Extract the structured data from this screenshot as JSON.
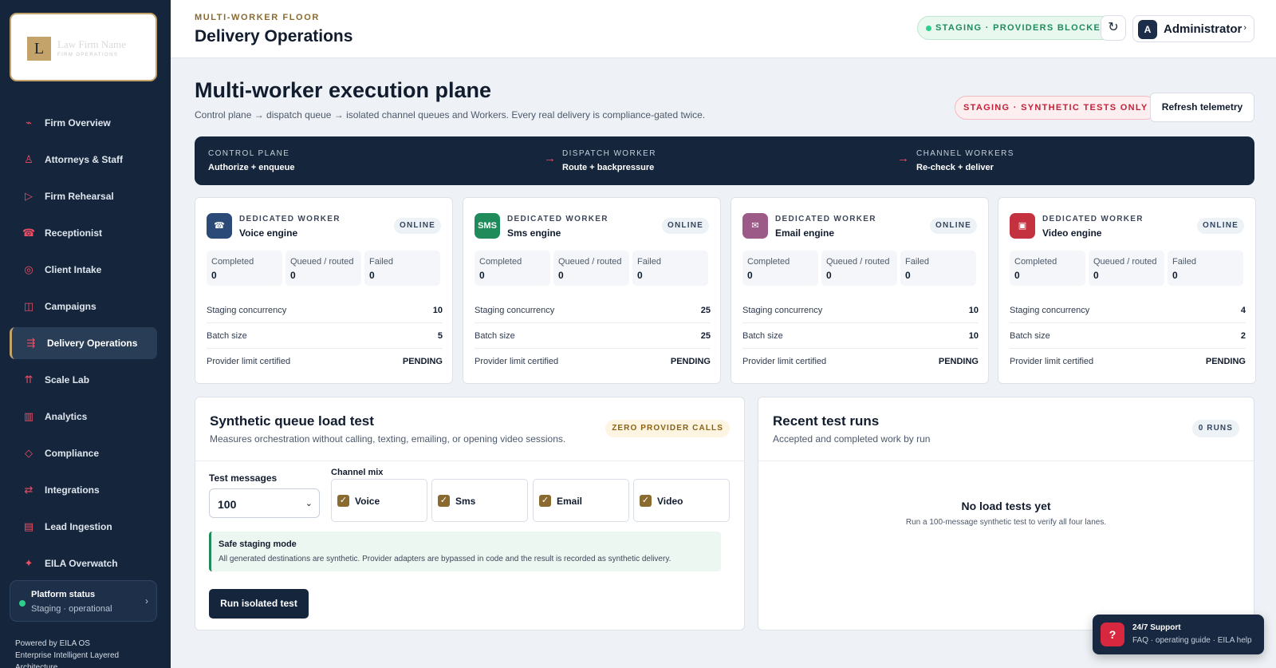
{
  "brand": {
    "logo_letter": "L",
    "name": "Law Firm Name",
    "tagline": "FIRM OPERATIONS"
  },
  "sidebar": {
    "items": [
      {
        "label": "Firm Overview",
        "icon": "trend-icon",
        "glyph": "⌁"
      },
      {
        "label": "Attorneys & Staff",
        "icon": "person-icon",
        "glyph": "♙"
      },
      {
        "label": "Firm Rehearsal",
        "icon": "play-icon",
        "glyph": "▷"
      },
      {
        "label": "Receptionist",
        "icon": "phone-icon",
        "glyph": "☎"
      },
      {
        "label": "Client Intake",
        "icon": "target-icon",
        "glyph": "◎"
      },
      {
        "label": "Campaigns",
        "icon": "columns-icon",
        "glyph": "◫"
      },
      {
        "label": "Delivery Operations",
        "icon": "dispatch-icon",
        "glyph": "⇶"
      },
      {
        "label": "Scale Lab",
        "icon": "scale-icon",
        "glyph": "⇈"
      },
      {
        "label": "Analytics",
        "icon": "bar-chart-icon",
        "glyph": "▥"
      },
      {
        "label": "Compliance",
        "icon": "diamond-icon",
        "glyph": "◇"
      },
      {
        "label": "Integrations",
        "icon": "swap-icon",
        "glyph": "⇄"
      },
      {
        "label": "Lead Ingestion",
        "icon": "list-icon",
        "glyph": "▤"
      },
      {
        "label": "EILA Overwatch",
        "icon": "spark-icon",
        "glyph": "✦"
      }
    ],
    "active_index": 6,
    "status": {
      "title": "Platform status",
      "subtitle": "Staging · operational",
      "chevron": "›"
    },
    "powered_line1": "Powered by EILA OS",
    "powered_line2": "Enterprise Intelligent Layered",
    "powered_line3": "Architecture"
  },
  "header": {
    "eyebrow": "MULTI-WORKER FLOOR",
    "title": "Delivery Operations",
    "env_pill": "STAGING · PROVIDERS BLOCKED",
    "refresh_glyph": "↻",
    "user_initial": "A",
    "user_name": "Administrator",
    "user_chevron": "›"
  },
  "main": {
    "title": "Multi-worker execution plane",
    "subtitle": "Control plane → dispatch queue → isolated channel queues and Workers. Every real delivery is compliance-gated twice.",
    "mode_pill": "STAGING · SYNTHETIC TESTS ONLY",
    "telemetry_button": "Refresh telemetry"
  },
  "pipeline": {
    "arrow": "→",
    "steps": [
      {
        "label": "CONTROL PLANE",
        "value": "Authorize + enqueue"
      },
      {
        "label": "DISPATCH WORKER",
        "value": "Route + backpressure"
      },
      {
        "label": "CHANNEL WORKERS",
        "value": "Re-check + deliver"
      }
    ]
  },
  "workers": {
    "kicker": "DEDICATED WORKER",
    "status": "ONLINE",
    "stat_labels": [
      "Completed",
      "Queued / routed",
      "Failed"
    ],
    "row_labels": [
      "Staging concurrency",
      "Batch size",
      "Provider limit certified"
    ],
    "items": [
      {
        "name": "Voice engine",
        "badge": "☎",
        "badge_icon": "phone-icon",
        "color": "#2b4a78",
        "completed": "0",
        "queued": "0",
        "failed": "0",
        "concurrency": "10",
        "batch": "5",
        "certified": "PENDING"
      },
      {
        "name": "Sms engine",
        "badge": "SMS",
        "badge_icon": "sms-icon",
        "color": "#1f8b5a",
        "completed": "0",
        "queued": "0",
        "failed": "0",
        "concurrency": "25",
        "batch": "25",
        "certified": "PENDING"
      },
      {
        "name": "Email engine",
        "badge": "✉",
        "badge_icon": "mail-icon",
        "color": "#9b5a88",
        "completed": "0",
        "queued": "0",
        "failed": "0",
        "concurrency": "10",
        "batch": "10",
        "certified": "PENDING"
      },
      {
        "name": "Video engine",
        "badge": "▣",
        "badge_icon": "video-icon",
        "color": "#c4313f",
        "completed": "0",
        "queued": "0",
        "failed": "0",
        "concurrency": "4",
        "batch": "2",
        "certified": "PENDING"
      }
    ]
  },
  "load_test": {
    "title": "Synthetic queue load test",
    "subtitle": "Measures orchestration without calling, texting, emailing, or opening video sessions.",
    "pill": "ZERO PROVIDER CALLS",
    "messages_label": "Test messages",
    "messages_value": "100",
    "select_chevron": "⌄",
    "mix_label": "Channel mix",
    "check_glyph": "✓",
    "channels": [
      "Voice",
      "Sms",
      "Email",
      "Video"
    ],
    "safe_title": "Safe staging mode",
    "safe_text": "All generated destinations are synthetic. Provider adapters are bypassed in code and the result is recorded as synthetic delivery.",
    "run_button": "Run isolated test"
  },
  "recent_runs": {
    "title": "Recent test runs",
    "subtitle": "Accepted and completed work by run",
    "pill": "0 RUNS",
    "empty_title": "No load tests yet",
    "empty_sub": "Run a 100-message synthetic test to verify all four lanes."
  },
  "support": {
    "glyph": "?",
    "title": "24/7 Support",
    "subtitle": "FAQ · operating guide · EILA help"
  },
  "colors": {
    "sidebar_bg": "#15263c",
    "accent_gold": "#c4a36a",
    "accent_red": "#ef4d64",
    "success_green": "#1f8b5a"
  }
}
